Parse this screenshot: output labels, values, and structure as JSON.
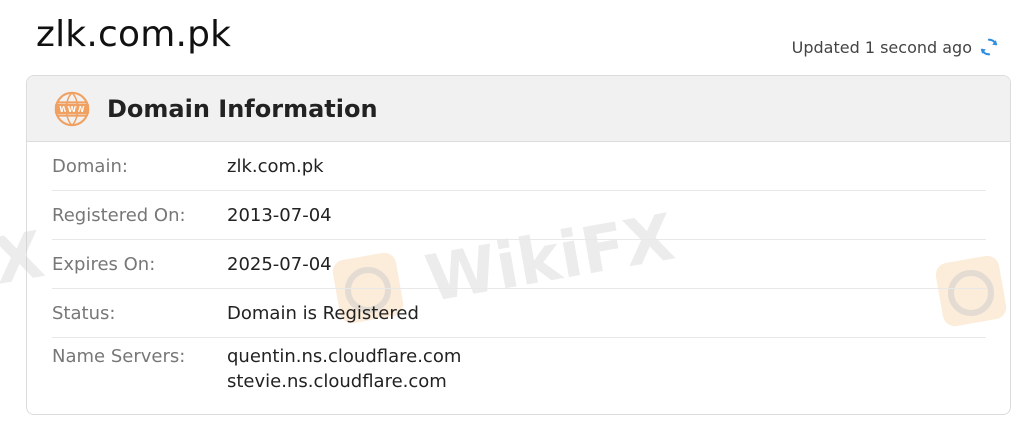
{
  "page": {
    "title": "zlk.com.pk",
    "updated_text": "Updated 1 second ago"
  },
  "card": {
    "title": "Domain Information",
    "rows": [
      {
        "label": "Domain:",
        "value": "zlk.com.pk"
      },
      {
        "label": "Registered On:",
        "value": "2013-07-04"
      },
      {
        "label": "Expires On:",
        "value": "2025-07-04"
      },
      {
        "label": "Status:",
        "value": "Domain is Registered"
      },
      {
        "label": "Name Servers:",
        "values": [
          "quentin.ns.cloudflare.com",
          "stevie.ns.cloudflare.com"
        ]
      }
    ]
  },
  "watermark": {
    "text": "WikiFX"
  },
  "icons": {
    "header": "www-globe-icon",
    "refresh": "refresh-icon"
  },
  "colors": {
    "accent_orange": "#f0a060",
    "refresh_blue": "#2f8ee0"
  }
}
